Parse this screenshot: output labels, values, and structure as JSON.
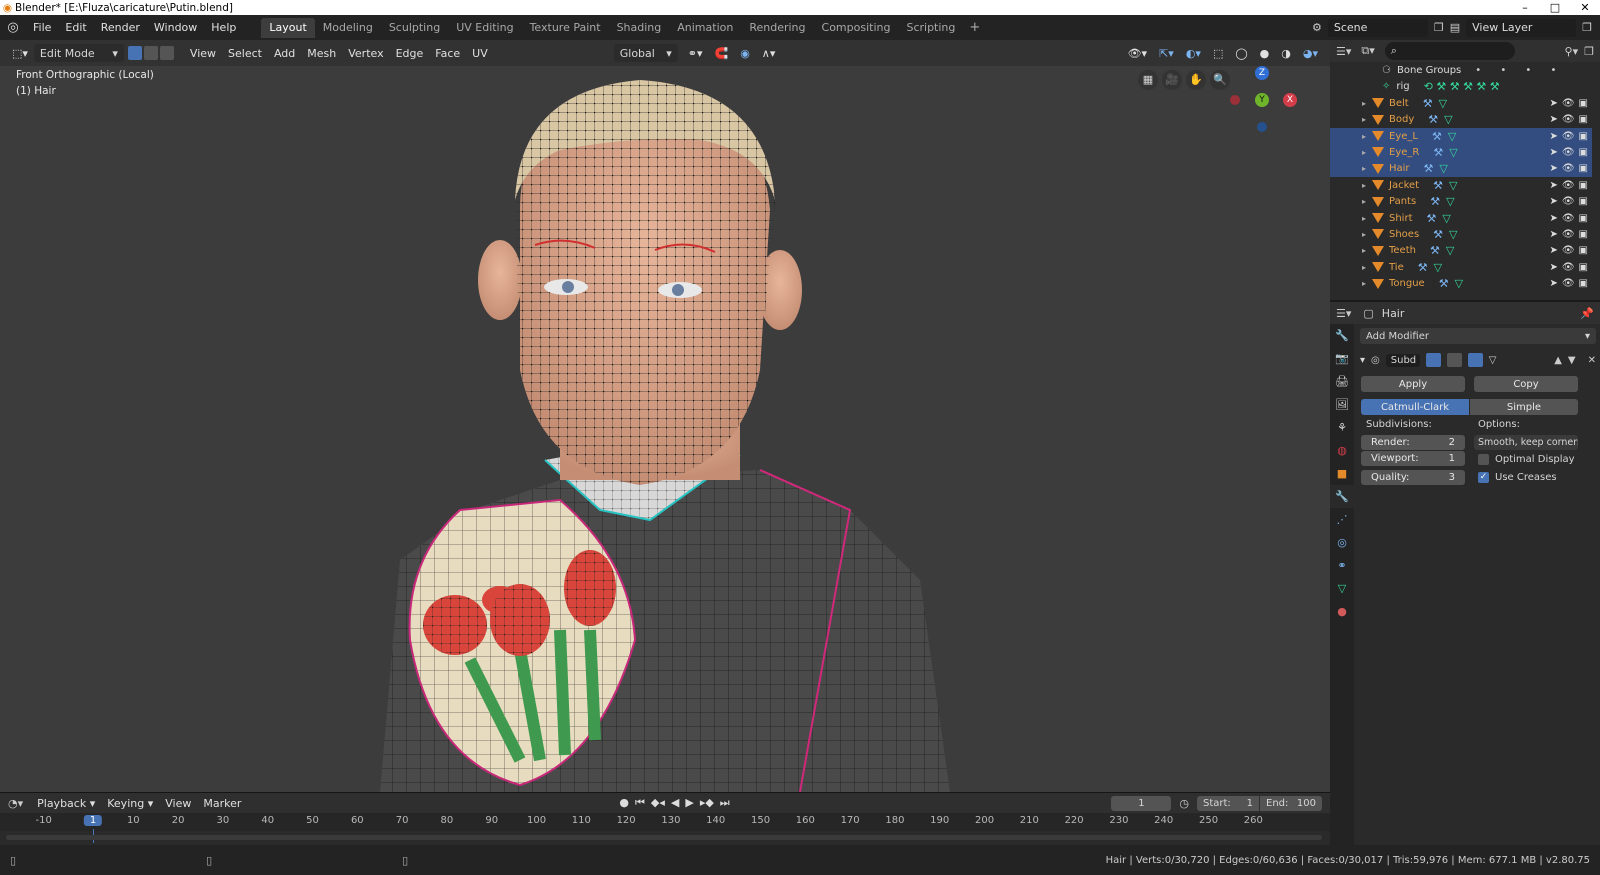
{
  "titlebar": {
    "title": "Blender* [E:\\Fluza\\caricature\\Putin.blend]"
  },
  "menu": [
    "File",
    "Edit",
    "Render",
    "Window",
    "Help"
  ],
  "workspaces": [
    "Layout",
    "Modeling",
    "Sculpting",
    "UV Editing",
    "Texture Paint",
    "Shading",
    "Animation",
    "Rendering",
    "Compositing",
    "Scripting"
  ],
  "active_workspace": "Layout",
  "scene": {
    "name": "Scene",
    "view_layer": "View Layer"
  },
  "viewport_header": {
    "mode": "Edit Mode",
    "menus": [
      "View",
      "Select",
      "Add",
      "Mesh",
      "Vertex",
      "Edge",
      "Face",
      "UV"
    ],
    "orientation": "Global"
  },
  "viewport_info": {
    "view": "Front Orthographic (Local)",
    "object": "(1) Hair"
  },
  "gizmo": {
    "z": "Z",
    "y": "Y",
    "x": "X"
  },
  "outliner": {
    "bone_groups": "Bone Groups",
    "rig": "rig",
    "items": [
      {
        "name": "Belt",
        "selected": false
      },
      {
        "name": "Body",
        "selected": false
      },
      {
        "name": "Eye_L",
        "selected": true
      },
      {
        "name": "Eye_R",
        "selected": true
      },
      {
        "name": "Hair",
        "selected": true
      },
      {
        "name": "Jacket",
        "selected": false
      },
      {
        "name": "Pants",
        "selected": false
      },
      {
        "name": "Shirt",
        "selected": false
      },
      {
        "name": "Shoes",
        "selected": false
      },
      {
        "name": "Teeth",
        "selected": false
      },
      {
        "name": "Tie",
        "selected": false
      },
      {
        "name": "Tongue",
        "selected": false
      }
    ]
  },
  "properties": {
    "object_name": "Hair",
    "add_modifier": "Add Modifier",
    "modifier_name": "Subd",
    "apply": "Apply",
    "copy": "Copy",
    "catmull": "Catmull-Clark",
    "simple": "Simple",
    "subdivisions_label": "Subdivisions:",
    "options_label": "Options:",
    "render_label": "Render:",
    "render_value": "2",
    "viewport_label": "Viewport:",
    "viewport_value": "1",
    "quality_label": "Quality:",
    "quality_value": "3",
    "uv_smooth": "Smooth, keep corners",
    "optimal_display": "Optimal Display",
    "use_creases": "Use Creases"
  },
  "timeline": {
    "menus": [
      "Playback",
      "Keying",
      "View",
      "Marker"
    ],
    "current_frame": "1",
    "start_label": "Start:",
    "start": "1",
    "end_label": "End:",
    "end": "100",
    "ticks": [
      "-10",
      "1",
      "10",
      "20",
      "30",
      "40",
      "50",
      "60",
      "70",
      "80",
      "90",
      "100",
      "110",
      "120",
      "130",
      "140",
      "150",
      "160",
      "170",
      "180",
      "190",
      "200",
      "210",
      "220",
      "230",
      "240",
      "250",
      "260"
    ]
  },
  "statusbar": {
    "stats": "Hair | Verts:0/30,720 | Edges:0/60,636 | Faces:0/30,017 | Tris:59,976 | Mem: 677.1 MB | v2.80.75"
  },
  "colors": {
    "accent": "#4772b3",
    "selected_row": "#334d80",
    "object_name": "#e39f49",
    "viewport_bg": "#3c3c3c"
  }
}
